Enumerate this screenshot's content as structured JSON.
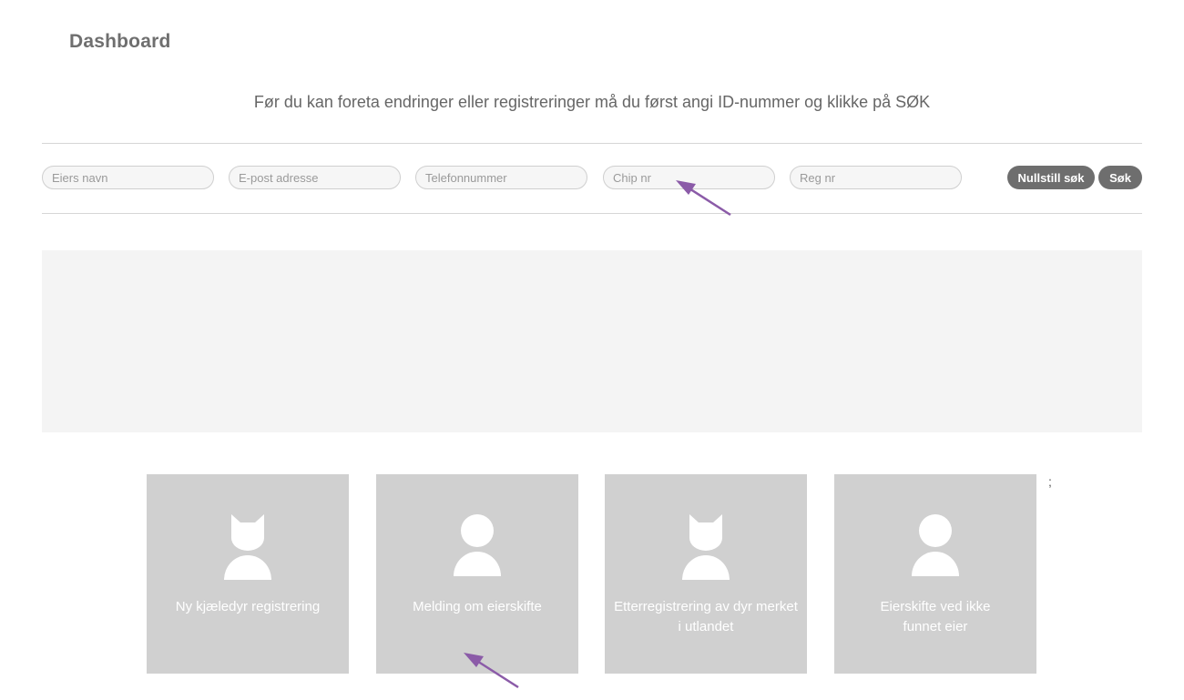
{
  "header": {
    "title": "Dashboard"
  },
  "instruction": "Før du kan foreta endringer eller registreringer må du først angi ID-nummer og klikke på SØK",
  "search": {
    "fields": [
      {
        "placeholder": "Eiers navn",
        "value": ""
      },
      {
        "placeholder": "E-post adresse",
        "value": ""
      },
      {
        "placeholder": "Telefonnummer",
        "value": ""
      },
      {
        "placeholder": "Chip nr",
        "value": ""
      },
      {
        "placeholder": "Reg nr",
        "value": ""
      }
    ],
    "reset_label": "Nullstill søk",
    "search_label": "Søk"
  },
  "tiles": [
    {
      "label": "Ny kjæledyr registrering",
      "icon": "cat-icon"
    },
    {
      "label": "Melding om eierskifte",
      "icon": "person-icon"
    },
    {
      "label": "Etterregistrering av dyr merket i utlandet",
      "icon": "cat-icon"
    },
    {
      "label": "Eierskifte ved ikke funnet eier",
      "icon": "person-icon"
    }
  ],
  "stray_text": ";",
  "colors": {
    "tile_bg": "#d0d0d0",
    "button_bg": "#6e6e6e",
    "panel_bg": "#f4f4f4",
    "annotation_arrow": "#8b5ba8"
  }
}
